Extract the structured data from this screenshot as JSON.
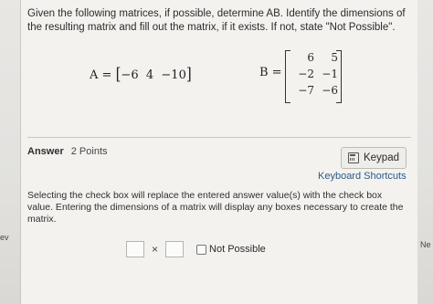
{
  "question": {
    "text": "Given the following matrices, if possible, determine AB. Identify the dimensions of the resulting matrix and fill out the matrix, if it exists. If not, state \"Not Possible\"."
  },
  "matrix_a": {
    "label": "A =",
    "values": [
      "−6",
      "4",
      "−10"
    ]
  },
  "matrix_b": {
    "label": "B =",
    "rows": [
      [
        "6",
        "5"
      ],
      [
        "−2",
        "−1"
      ],
      [
        "−7",
        "−6"
      ]
    ]
  },
  "answer": {
    "heading": "Answer",
    "points": "2 Points",
    "keypad_label": "Keypad",
    "shortcuts_label": "Keyboard Shortcuts",
    "hint": "Selecting the check box will replace the entered answer value(s) with the check box value. Entering the dimensions of a matrix will display any boxes necessary to create the matrix.",
    "times_symbol": "×",
    "not_possible_label": "Not Possible"
  },
  "edges": {
    "left_text": "ev",
    "right_text": "Ne"
  }
}
